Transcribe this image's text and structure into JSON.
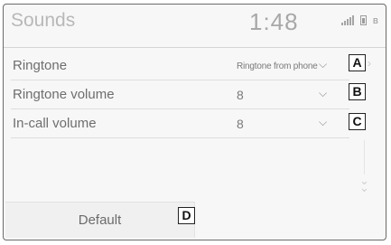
{
  "header": {
    "title": "Sounds",
    "time": "1:48"
  },
  "status_icons": [
    "signal-icon",
    "battery-icon",
    "bluetooth-icon"
  ],
  "rows": [
    {
      "label": "Ringtone",
      "value": "Ringtone from phone",
      "callout": "A"
    },
    {
      "label": "Ringtone volume",
      "value": "8",
      "callout": "B"
    },
    {
      "label": "In-call volume",
      "value": "8",
      "callout": "C"
    }
  ],
  "default_button": {
    "label": "Default",
    "callout": "D"
  },
  "colors": {
    "background": "#f7f7f7",
    "text": "#6e6e6e",
    "frame": "#6a6a6a"
  }
}
